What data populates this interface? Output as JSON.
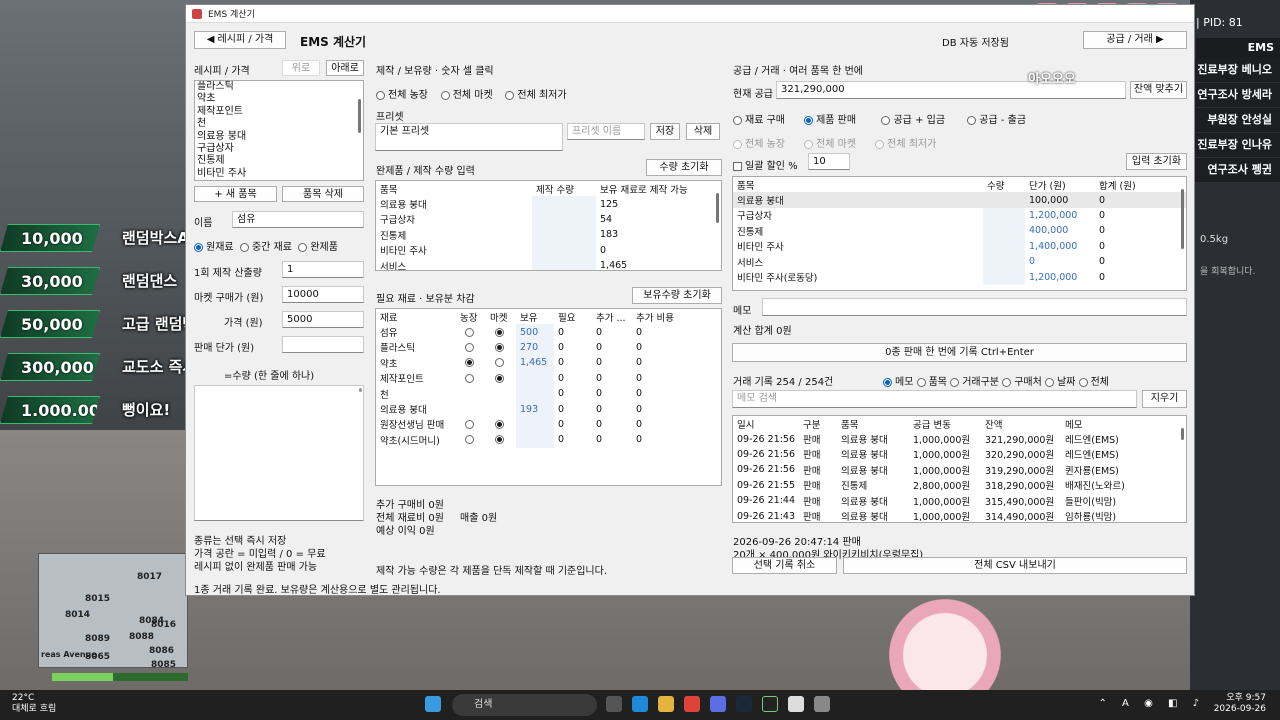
{
  "overlay": {
    "donations": [
      {
        "amount": "10,000",
        "label": "랜덤박스A"
      },
      {
        "amount": "30,000",
        "label": "랜덤댄스"
      },
      {
        "amount": "50,000",
        "label": "고급 랜덤박스A"
      },
      {
        "amount": "300,000",
        "label": "교도소 즉시 출소"
      },
      {
        "amount": "1.000.000",
        "label": "뻥이요!"
      }
    ],
    "pid": "| PID: 81",
    "ems": "EMS",
    "right_menu": [
      "진료부장 베니오",
      "연구조사 방세라",
      "부원장 안성실",
      "진료부장 인나유",
      "연구조사 펭귄"
    ],
    "weight": "0.5kg",
    "weight_note": "을 회복합니다.",
    "avatar_caption": "아오오오",
    "minimap_labels": [
      "8017",
      "8015",
      "8014",
      "8084",
      "8089",
      "8088",
      "8086",
      "8065",
      "8085",
      "8016",
      "reas Avenue"
    ]
  },
  "window": {
    "title": "EMS 계산기",
    "header": {
      "back_button": "◀ 레시피 / 가격",
      "app_title": "EMS 계산기",
      "autosave": "DB 자동 저장됨",
      "forward_button": "공급 / 거래 ▶"
    },
    "recipe_panel": {
      "heading": "레시피 / 가격",
      "up_button": "위로",
      "down_button": "아래로",
      "items": [
        "플라스틱",
        "약초",
        "제작포인트",
        "천",
        "의료용 붕대",
        "구급상자",
        "진통제",
        "비타민 주사"
      ],
      "new_item_button": "+ 새 품목",
      "delete_item_button": "품목 삭제",
      "name_label": "이름",
      "name_value": "섬유",
      "type_options": [
        {
          "label": "원재료",
          "selected": true
        },
        {
          "label": "중간 재료",
          "selected": false
        },
        {
          "label": "완제품",
          "selected": false
        }
      ],
      "yield_label": "1회 제작 산출량",
      "yield_value": "1",
      "market_price_label": "마켓 구매가 (원)",
      "market_price_value": "10000",
      "farm_price_label": "가격 (원)",
      "farm_price_value": "5000",
      "sell_price_label": "판매 단가 (원)",
      "sell_price_value": "",
      "recipe_hint": "=수량  (한 줄에 하나)",
      "notes": [
        "종류는 선택 즉시 저장",
        "가격 공란 = 미입력 / 0 = 무료",
        "레시피 없이 완제품 판매 가능"
      ]
    },
    "craft_panel": {
      "heading": "제작 / 보유량  · 숫자 셀 클릭",
      "source_options": [
        {
          "label": "전체 농장",
          "selected": false
        },
        {
          "label": "전체 마켓",
          "selected": false
        },
        {
          "label": "전체 최저가",
          "selected": false
        }
      ],
      "preset_label": "프리셋",
      "preset_value": "기본 프리셋",
      "preset_name_placeholder": "프리셋 이름",
      "save_button": "저장",
      "delete_button": "삭제",
      "products_heading": "완제품  /  제작 수량 입력",
      "reset_qty_button": "수량 초기화",
      "products_columns": [
        "품목",
        "제작 수량",
        "보유 재료로 제작 가능"
      ],
      "products": [
        {
          "name": "의료용 붕대",
          "qty": "",
          "possible": "125"
        },
        {
          "name": "구급상자",
          "qty": "",
          "possible": "54"
        },
        {
          "name": "진통제",
          "qty": "",
          "possible": "183"
        },
        {
          "name": "비타민 주사",
          "qty": "",
          "possible": "0"
        },
        {
          "name": "서비스",
          "qty": "",
          "possible": "1,465"
        }
      ],
      "materials_heading": "필요 재료 · 보유분 차감",
      "reset_stock_button": "보유수량 초기화",
      "materials_columns": [
        "재료",
        "농장",
        "마켓",
        "보유",
        "필요",
        "추가 ...",
        "추가 비용"
      ],
      "materials": [
        {
          "name": "섬유",
          "farm": false,
          "market": true,
          "stock": "500",
          "need": "0",
          "extra": "0",
          "cost": "0"
        },
        {
          "name": "플라스틱",
          "farm": false,
          "market": true,
          "stock": "270",
          "need": "0",
          "extra": "0",
          "cost": "0"
        },
        {
          "name": "약초",
          "farm": true,
          "market": false,
          "stock": "1,465",
          "need": "0",
          "extra": "0",
          "cost": "0"
        },
        {
          "name": "제작포인트",
          "farm": false,
          "market": true,
          "stock": "",
          "need": "0",
          "extra": "0",
          "cost": "0"
        },
        {
          "name": "천",
          "farm": null,
          "market": null,
          "stock": "",
          "need": "0",
          "extra": "0",
          "cost": "0"
        },
        {
          "name": "의료용 붕대",
          "farm": null,
          "market": null,
          "stock": "193",
          "need": "0",
          "extra": "0",
          "cost": "0"
        },
        {
          "name": "원장선생님 판매",
          "farm": false,
          "market": true,
          "stock": "",
          "need": "0",
          "extra": "0",
          "cost": "0"
        },
        {
          "name": "약초(시드머니)",
          "farm": false,
          "market": true,
          "stock": "",
          "need": "0",
          "extra": "0",
          "cost": "0"
        }
      ],
      "summary": {
        "extra_buy": "추가 구매비  0원",
        "total_material": "전체 재료비  0원",
        "revenue": "매출  0원",
        "profit": "예상 이익  0원"
      },
      "footnote": "제작 가능 수량은 각 제품을 단독 제작할 때 기준입니다."
    },
    "supply_panel": {
      "heading": "공급 / 거래  · 여러 품목 한 번에",
      "current_supply_label": "현재 공급",
      "current_supply_value": "321,290,000",
      "fit_balance_button": "잔액 맞추기",
      "mode_options": [
        {
          "label": "재료 구매",
          "selected": false
        },
        {
          "label": "제품 판매",
          "selected": true
        },
        {
          "label": "공급 + 입금",
          "selected": false
        },
        {
          "label": "공급 - 출금",
          "selected": false
        }
      ],
      "scope_options": [
        "전체 농장",
        "전체 마켓",
        "전체 최저가"
      ],
      "bulk_discount_label": "일괄 할인 %",
      "bulk_discount_value": "10",
      "reset_input_button": "입력 초기화",
      "items_columns": [
        "품목",
        "수량",
        "단가 (원)",
        "합계 (원)"
      ],
      "items": [
        {
          "name": "의료용 붕대",
          "qty": "",
          "price": "100,000",
          "total": "0"
        },
        {
          "name": "구급상자",
          "qty": "",
          "price": "1,200,000",
          "total": "0"
        },
        {
          "name": "진통제",
          "qty": "",
          "price": "400,000",
          "total": "0"
        },
        {
          "name": "비타민 주사",
          "qty": "",
          "price": "1,400,000",
          "total": "0"
        },
        {
          "name": "서비스",
          "qty": "",
          "price": "0",
          "total": "0"
        },
        {
          "name": "비타민 주사(로동당)",
          "qty": "",
          "price": "1,200,000",
          "total": "0"
        }
      ],
      "memo_label": "메모",
      "memo_value": "",
      "calc_total": "계산 합계  0원",
      "record_button": "0종 판매 한 번에 기록   Ctrl+Enter",
      "history_heading": "거래 기록  254 / 254건",
      "filter_options": [
        {
          "label": "메모",
          "selected": true
        },
        {
          "label": "품목",
          "selected": false
        },
        {
          "label": "거래구분",
          "selected": false
        },
        {
          "label": "구매처",
          "selected": false
        },
        {
          "label": "날짜",
          "selected": false
        },
        {
          "label": "전체",
          "selected": false
        }
      ],
      "search_placeholder": "메모 검색",
      "clear_button": "지우기",
      "history_columns": [
        "일시",
        "구분",
        "품목",
        "공급 변동",
        "잔액",
        "메모"
      ],
      "history": [
        {
          "time": "09-26 21:56",
          "kind": "판매",
          "item": "의료용 붕대",
          "delta": "1,000,000원",
          "balance": "321,290,000원",
          "memo": "레드엔(EMS)"
        },
        {
          "time": "09-26 21:56",
          "kind": "판매",
          "item": "의료용 붕대",
          "delta": "1,000,000원",
          "balance": "320,290,000원",
          "memo": "레드엔(EMS)"
        },
        {
          "time": "09-26 21:56",
          "kind": "판매",
          "item": "의료용 붕대",
          "delta": "1,000,000원",
          "balance": "319,290,000원",
          "memo": "퀸자룡(EMS)"
        },
        {
          "time": "09-26 21:55",
          "kind": "판매",
          "item": "진통제",
          "delta": "2,800,000원",
          "balance": "318,290,000원",
          "memo": "배재진(노와르)"
        },
        {
          "time": "09-26 21:44",
          "kind": "판매",
          "item": "의료용 붕대",
          "delta": "1,000,000원",
          "balance": "315,490,000원",
          "memo": "들판이(빅맘)"
        },
        {
          "time": "09-26 21:43",
          "kind": "판매",
          "item": "의료용 붕대",
          "delta": "1,000,000원",
          "balance": "314,490,000원",
          "memo": "임하룡(빅맘)"
        }
      ],
      "detail_line1": "2026-09-26 20:47:14  판매",
      "detail_line2": "20개 × 400,000원  와이키키비치(우렁무집)",
      "cancel_button": "선택 기록 취소",
      "export_button": "전체 CSV 내보내기"
    },
    "status_bar": "1종 거래 기록 완료. 보유량은 계산용으로 별도 관리됩니다."
  },
  "taskbar": {
    "temp": "22°C",
    "weather": "대체로 흐림",
    "search": "검색",
    "time": "오후 9:57",
    "date": "2026-09-26"
  }
}
